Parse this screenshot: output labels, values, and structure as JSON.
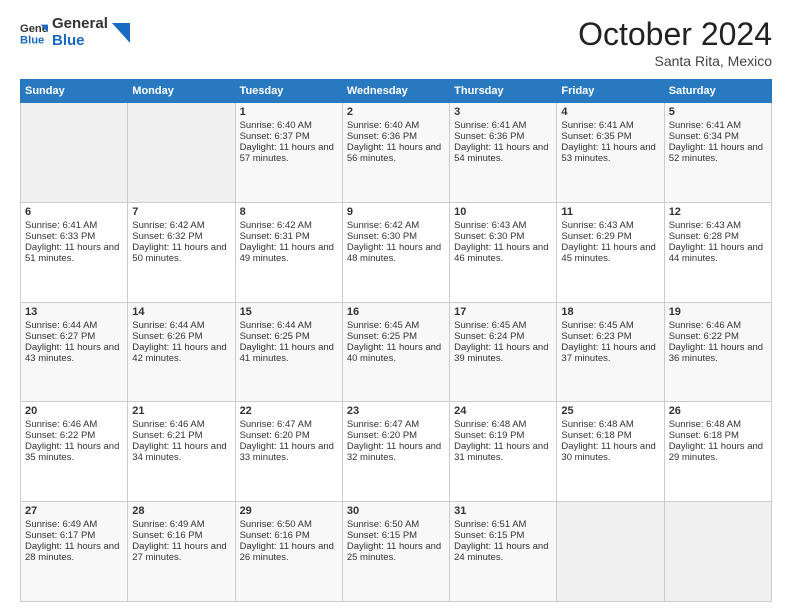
{
  "logo": {
    "general": "General",
    "blue": "Blue"
  },
  "header": {
    "month": "October 2024",
    "location": "Santa Rita, Mexico"
  },
  "weekdays": [
    "Sunday",
    "Monday",
    "Tuesday",
    "Wednesday",
    "Thursday",
    "Friday",
    "Saturday"
  ],
  "weeks": [
    [
      {
        "day": "",
        "info": ""
      },
      {
        "day": "",
        "info": ""
      },
      {
        "day": "1",
        "info": "Sunrise: 6:40 AM\nSunset: 6:37 PM\nDaylight: 11 hours and 57 minutes."
      },
      {
        "day": "2",
        "info": "Sunrise: 6:40 AM\nSunset: 6:36 PM\nDaylight: 11 hours and 56 minutes."
      },
      {
        "day": "3",
        "info": "Sunrise: 6:41 AM\nSunset: 6:36 PM\nDaylight: 11 hours and 54 minutes."
      },
      {
        "day": "4",
        "info": "Sunrise: 6:41 AM\nSunset: 6:35 PM\nDaylight: 11 hours and 53 minutes."
      },
      {
        "day": "5",
        "info": "Sunrise: 6:41 AM\nSunset: 6:34 PM\nDaylight: 11 hours and 52 minutes."
      }
    ],
    [
      {
        "day": "6",
        "info": "Sunrise: 6:41 AM\nSunset: 6:33 PM\nDaylight: 11 hours and 51 minutes."
      },
      {
        "day": "7",
        "info": "Sunrise: 6:42 AM\nSunset: 6:32 PM\nDaylight: 11 hours and 50 minutes."
      },
      {
        "day": "8",
        "info": "Sunrise: 6:42 AM\nSunset: 6:31 PM\nDaylight: 11 hours and 49 minutes."
      },
      {
        "day": "9",
        "info": "Sunrise: 6:42 AM\nSunset: 6:30 PM\nDaylight: 11 hours and 48 minutes."
      },
      {
        "day": "10",
        "info": "Sunrise: 6:43 AM\nSunset: 6:30 PM\nDaylight: 11 hours and 46 minutes."
      },
      {
        "day": "11",
        "info": "Sunrise: 6:43 AM\nSunset: 6:29 PM\nDaylight: 11 hours and 45 minutes."
      },
      {
        "day": "12",
        "info": "Sunrise: 6:43 AM\nSunset: 6:28 PM\nDaylight: 11 hours and 44 minutes."
      }
    ],
    [
      {
        "day": "13",
        "info": "Sunrise: 6:44 AM\nSunset: 6:27 PM\nDaylight: 11 hours and 43 minutes."
      },
      {
        "day": "14",
        "info": "Sunrise: 6:44 AM\nSunset: 6:26 PM\nDaylight: 11 hours and 42 minutes."
      },
      {
        "day": "15",
        "info": "Sunrise: 6:44 AM\nSunset: 6:25 PM\nDaylight: 11 hours and 41 minutes."
      },
      {
        "day": "16",
        "info": "Sunrise: 6:45 AM\nSunset: 6:25 PM\nDaylight: 11 hours and 40 minutes."
      },
      {
        "day": "17",
        "info": "Sunrise: 6:45 AM\nSunset: 6:24 PM\nDaylight: 11 hours and 39 minutes."
      },
      {
        "day": "18",
        "info": "Sunrise: 6:45 AM\nSunset: 6:23 PM\nDaylight: 11 hours and 37 minutes."
      },
      {
        "day": "19",
        "info": "Sunrise: 6:46 AM\nSunset: 6:22 PM\nDaylight: 11 hours and 36 minutes."
      }
    ],
    [
      {
        "day": "20",
        "info": "Sunrise: 6:46 AM\nSunset: 6:22 PM\nDaylight: 11 hours and 35 minutes."
      },
      {
        "day": "21",
        "info": "Sunrise: 6:46 AM\nSunset: 6:21 PM\nDaylight: 11 hours and 34 minutes."
      },
      {
        "day": "22",
        "info": "Sunrise: 6:47 AM\nSunset: 6:20 PM\nDaylight: 11 hours and 33 minutes."
      },
      {
        "day": "23",
        "info": "Sunrise: 6:47 AM\nSunset: 6:20 PM\nDaylight: 11 hours and 32 minutes."
      },
      {
        "day": "24",
        "info": "Sunrise: 6:48 AM\nSunset: 6:19 PM\nDaylight: 11 hours and 31 minutes."
      },
      {
        "day": "25",
        "info": "Sunrise: 6:48 AM\nSunset: 6:18 PM\nDaylight: 11 hours and 30 minutes."
      },
      {
        "day": "26",
        "info": "Sunrise: 6:48 AM\nSunset: 6:18 PM\nDaylight: 11 hours and 29 minutes."
      }
    ],
    [
      {
        "day": "27",
        "info": "Sunrise: 6:49 AM\nSunset: 6:17 PM\nDaylight: 11 hours and 28 minutes."
      },
      {
        "day": "28",
        "info": "Sunrise: 6:49 AM\nSunset: 6:16 PM\nDaylight: 11 hours and 27 minutes."
      },
      {
        "day": "29",
        "info": "Sunrise: 6:50 AM\nSunset: 6:16 PM\nDaylight: 11 hours and 26 minutes."
      },
      {
        "day": "30",
        "info": "Sunrise: 6:50 AM\nSunset: 6:15 PM\nDaylight: 11 hours and 25 minutes."
      },
      {
        "day": "31",
        "info": "Sunrise: 6:51 AM\nSunset: 6:15 PM\nDaylight: 11 hours and 24 minutes."
      },
      {
        "day": "",
        "info": ""
      },
      {
        "day": "",
        "info": ""
      }
    ]
  ]
}
